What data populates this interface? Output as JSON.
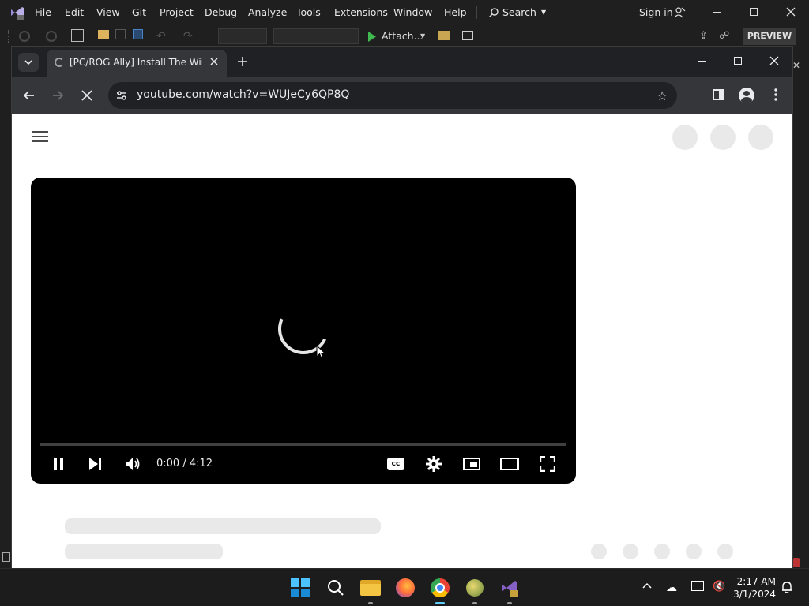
{
  "vs": {
    "menu": [
      "File",
      "Edit",
      "View",
      "Git",
      "Project",
      "Debug",
      "Analyze",
      "Tools",
      "Extensions",
      "Window",
      "Help"
    ],
    "search_label": "Search",
    "signin_label": "Sign in",
    "attach_label": "Attach...",
    "preview_label": "PREVIEW"
  },
  "browser": {
    "tab_title": "[PC/ROG Ally] Install The Wii Sy",
    "url": "youtube.com/watch?v=WUJeCy6QP8Q"
  },
  "player": {
    "time": "0:00 / 4:12",
    "progress": 0.0
  },
  "taskbar": {
    "time": "2:17 AM",
    "date": "3/1/2024"
  },
  "colors": {
    "vs_accent": "#8661c5",
    "youtube_red": "#ff0000",
    "chrome_dark": "#35363a"
  }
}
